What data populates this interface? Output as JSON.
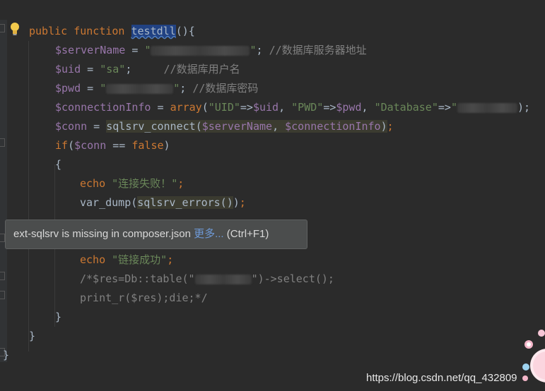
{
  "code": {
    "line1": {
      "kw_public": "public",
      "kw_function": "function",
      "fn_name": "testdll",
      "paren": "(){"
    },
    "line2": {
      "var": "$serverName",
      "op": " = ",
      "q1": "\"",
      "q2": "\"",
      "rest": "; ",
      "cmt": "//数据库服务器地址"
    },
    "line3": {
      "var": "$uid",
      "op": " = ",
      "str": "\"sa\"",
      "rest": ";     ",
      "cmt": "//数据库用户名"
    },
    "line4": {
      "var": "$pwd",
      "op": " = ",
      "q1": "\"",
      "q2": "\"",
      "rest": "; ",
      "cmt": "//数据库密码"
    },
    "line5": {
      "var": "$connectionInfo",
      "op": " = ",
      "call": "array",
      "p1": "(",
      "s1": "\"UID\"",
      "a1": "=>",
      "v1": "$uid",
      "c1": ", ",
      "s2": "\"PWD\"",
      "a2": "=>",
      "v2": "$pwd",
      "c2": ", ",
      "s3": "\"Database\"",
      "a3": "=>",
      "q1": "\"",
      "end": ");"
    },
    "line6": {
      "var": "$conn",
      "op": " = ",
      "fn": "sqlsrv_connect",
      "p1": "(",
      "a1": "$serverName",
      "c1": ", ",
      "a2": "$connectionInfo",
      "p2": ")",
      "end": ";"
    },
    "line7": {
      "kw": "if",
      "p1": "(",
      "var": "$conn",
      "op": " == ",
      "kw2": "false",
      "p2": ")"
    },
    "line8": {
      "brace": "{"
    },
    "line9": {
      "kw": "echo",
      "sp": " ",
      "str": "\"连接失败！\"",
      "end": ";"
    },
    "line10": {
      "fn": "var_dump",
      "p1": "(",
      "call": "sqlsrv_errors()",
      "p2": ")",
      "end": ";"
    },
    "line11": {
      "kw": "echo",
      "sp": " ",
      "str": "\"链接成功\"",
      "end": ";"
    },
    "line12": {
      "cmt1": "/*$res=Db::table(\"",
      "cmt2": "\")->select();"
    },
    "line13": {
      "cmt": "print_r($res);die;*/"
    },
    "line14": {
      "brace": "}"
    },
    "line15": {
      "brace": "}"
    },
    "line16": {
      "brace": "}"
    }
  },
  "tooltip": {
    "message": "ext-sqlsrv is missing in composer.json ",
    "more": "更多...",
    "shortcut": " (Ctrl+F1)"
  },
  "watermark": {
    "text": "https://blog.csdn.net/qq_432809"
  },
  "colors": {
    "background": "#2b2b2b",
    "keyword": "#cc7832",
    "variable": "#9876aa",
    "string": "#6a8759",
    "comment": "#808080",
    "function_highlight": "#214283"
  }
}
